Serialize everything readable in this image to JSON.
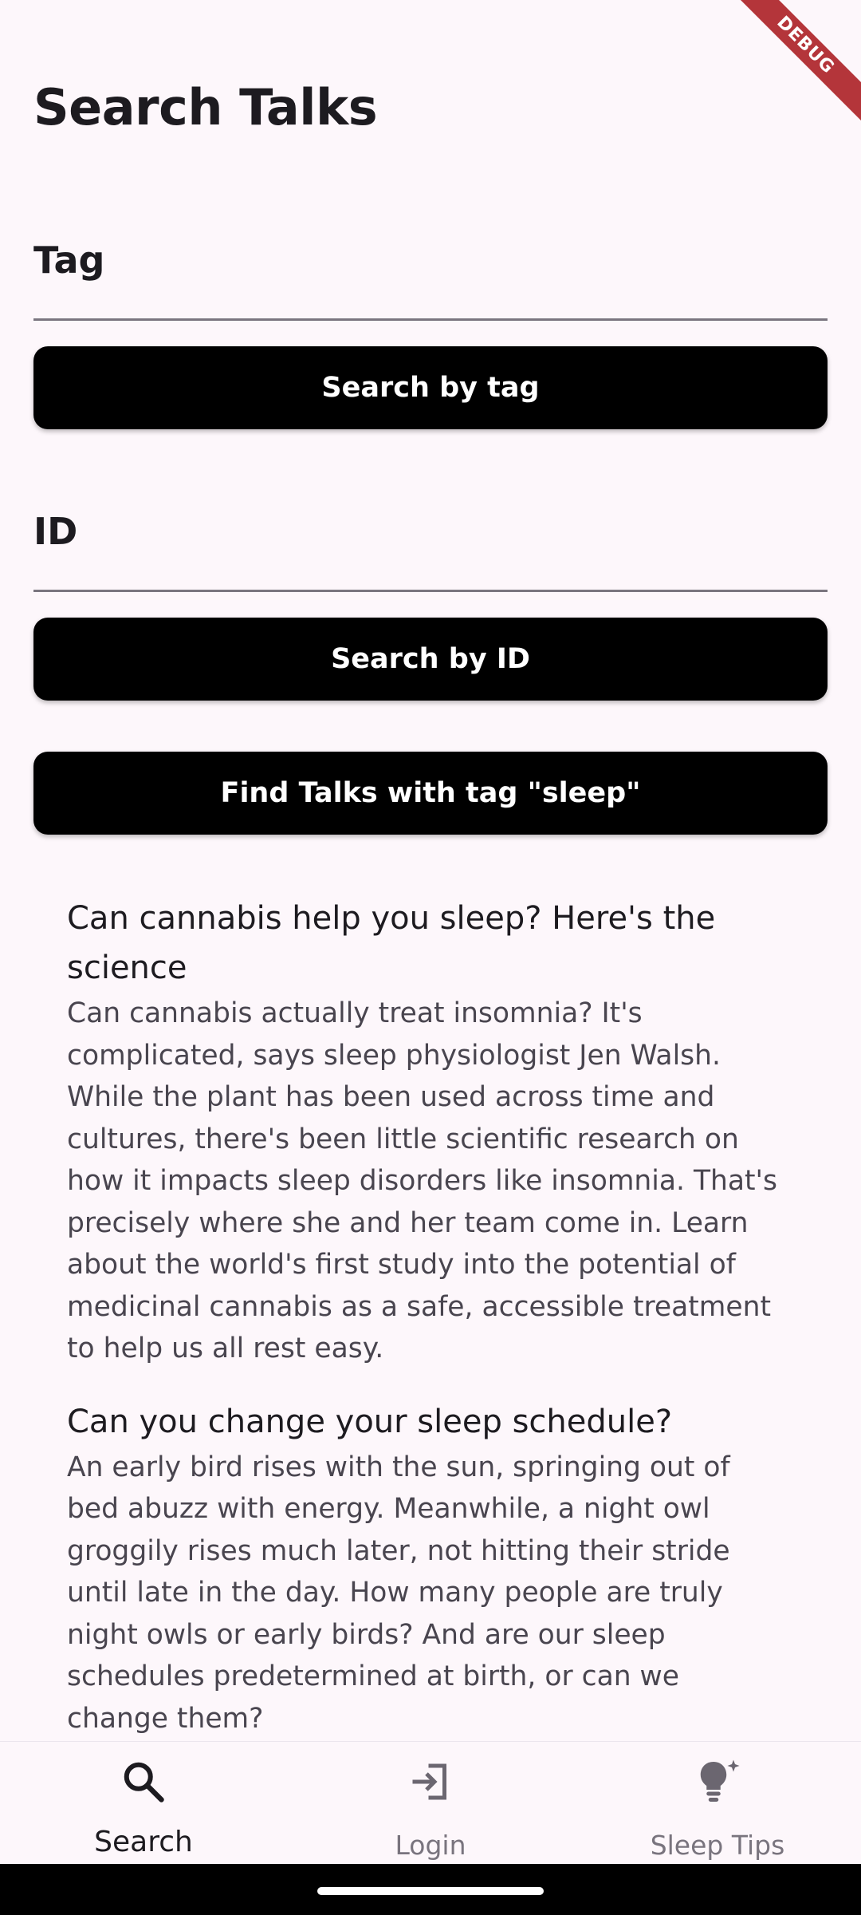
{
  "page": {
    "title": "Search Talks",
    "debug_label": "DEBUG"
  },
  "tag_field": {
    "label": "Tag",
    "value": ""
  },
  "search_tag_button": "Search by tag",
  "id_field": {
    "label": "ID",
    "value": ""
  },
  "search_id_button": "Search by ID",
  "find_sleep_button": "Find Talks with tag \"sleep\"",
  "results": [
    {
      "title": "Can cannabis help you sleep? Here's the science",
      "description": "Can cannabis actually treat insomnia? It's complicated, says sleep physiologist Jen Walsh. While the plant has been used across time and cultures, there's been little scientific research on how it impacts sleep disorders like insomnia. That's precisely where she and her team come in. Learn about the world's first study into the potential of medicinal cannabis as a safe, accessible treatment to help us all rest easy."
    },
    {
      "title": "Can you change your sleep schedule?",
      "description": "An early bird rises with the sun, springing out of bed abuzz with energy. Meanwhile, a night owl groggily rises much later, not hitting their stride until late in the day. How many people are truly night owls or early birds? And are our sleep schedules predetermined at birth, or can we change them?"
    }
  ],
  "bottom_nav": {
    "items": [
      {
        "label": "Search",
        "icon": "search-icon",
        "active": true
      },
      {
        "label": "Login",
        "icon": "login-icon",
        "active": false
      },
      {
        "label": "Sleep Tips",
        "icon": "lightbulb-icon",
        "active": false
      }
    ]
  },
  "colors": {
    "background": "#fdf7fb",
    "button": "#000000",
    "button_text": "#ffffff",
    "inactive_nav": "#79747e",
    "debug_banner": "#b4353a"
  }
}
